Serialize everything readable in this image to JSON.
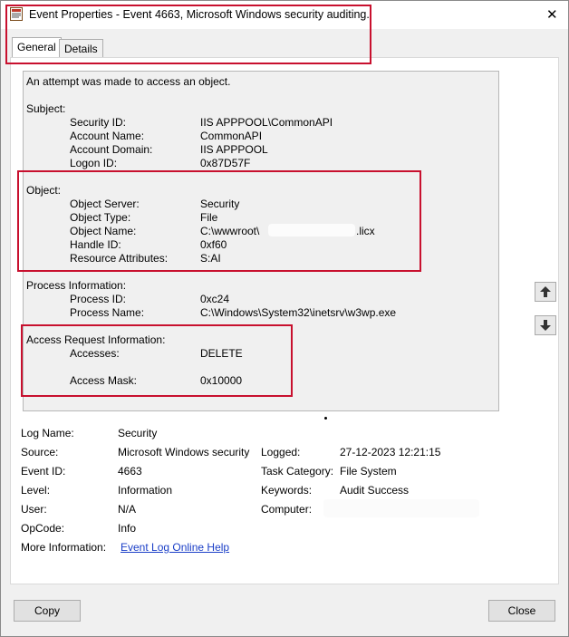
{
  "window": {
    "title": "Event Properties - Event 4663, Microsoft Windows security auditing.",
    "close_glyph": "✕"
  },
  "tabs": [
    {
      "label": "General",
      "selected": true
    },
    {
      "label": "Details",
      "selected": false
    }
  ],
  "description": {
    "intro": "An attempt was made to access an object.",
    "subject": {
      "header": "Subject:",
      "rows": [
        {
          "label": "Security ID:",
          "value": "IIS APPPOOL\\CommonAPI"
        },
        {
          "label": "Account Name:",
          "value": "CommonAPI"
        },
        {
          "label": "Account Domain:",
          "value": "IIS APPPOOL"
        },
        {
          "label": "Logon ID:",
          "value": "0x87D57F"
        }
      ]
    },
    "object": {
      "header": "Object:",
      "rows": [
        {
          "label": "Object Server:",
          "value": "Security"
        },
        {
          "label": "Object Type:",
          "value": "File"
        },
        {
          "label": "Object Name:",
          "value": "C:\\wwwroot\\"
        },
        {
          "label": "Handle ID:",
          "value": "0xf60"
        },
        {
          "label": "Resource Attributes:",
          "value": "S:AI"
        }
      ],
      "object_name_suffix": ".licx"
    },
    "process": {
      "header": "Process Information:",
      "rows": [
        {
          "label": "Process ID:",
          "value": "0xc24"
        },
        {
          "label": "Process Name:",
          "value": "C:\\Windows\\System32\\inetsrv\\w3wp.exe"
        }
      ]
    },
    "access": {
      "header": "Access Request Information:",
      "rows": [
        {
          "label": "Accesses:",
          "value": "DELETE"
        },
        {
          "label": "Access Mask:",
          "value": "0x10000"
        }
      ]
    }
  },
  "details": {
    "log_name": {
      "label": "Log Name:",
      "value": "Security"
    },
    "source": {
      "label": "Source:",
      "value": "Microsoft Windows security"
    },
    "logged": {
      "label": "Logged:",
      "value": "27-12-2023 12:21:15"
    },
    "event_id": {
      "label": "Event ID:",
      "value": "4663"
    },
    "task_category": {
      "label": "Task Category:",
      "value": "File System"
    },
    "level": {
      "label": "Level:",
      "value": "Information"
    },
    "keywords": {
      "label": "Keywords:",
      "value": "Audit Success"
    },
    "user": {
      "label": "User:",
      "value": "N/A"
    },
    "computer": {
      "label": "Computer:",
      "value": ""
    },
    "opcode": {
      "label": "OpCode:",
      "value": "Info"
    },
    "more_info": {
      "label": "More Information:",
      "link": "Event Log Online Help"
    }
  },
  "buttons": {
    "copy": "Copy",
    "close": "Close"
  },
  "colors": {
    "highlight": "#c8102e",
    "link": "#1a3ec7"
  }
}
